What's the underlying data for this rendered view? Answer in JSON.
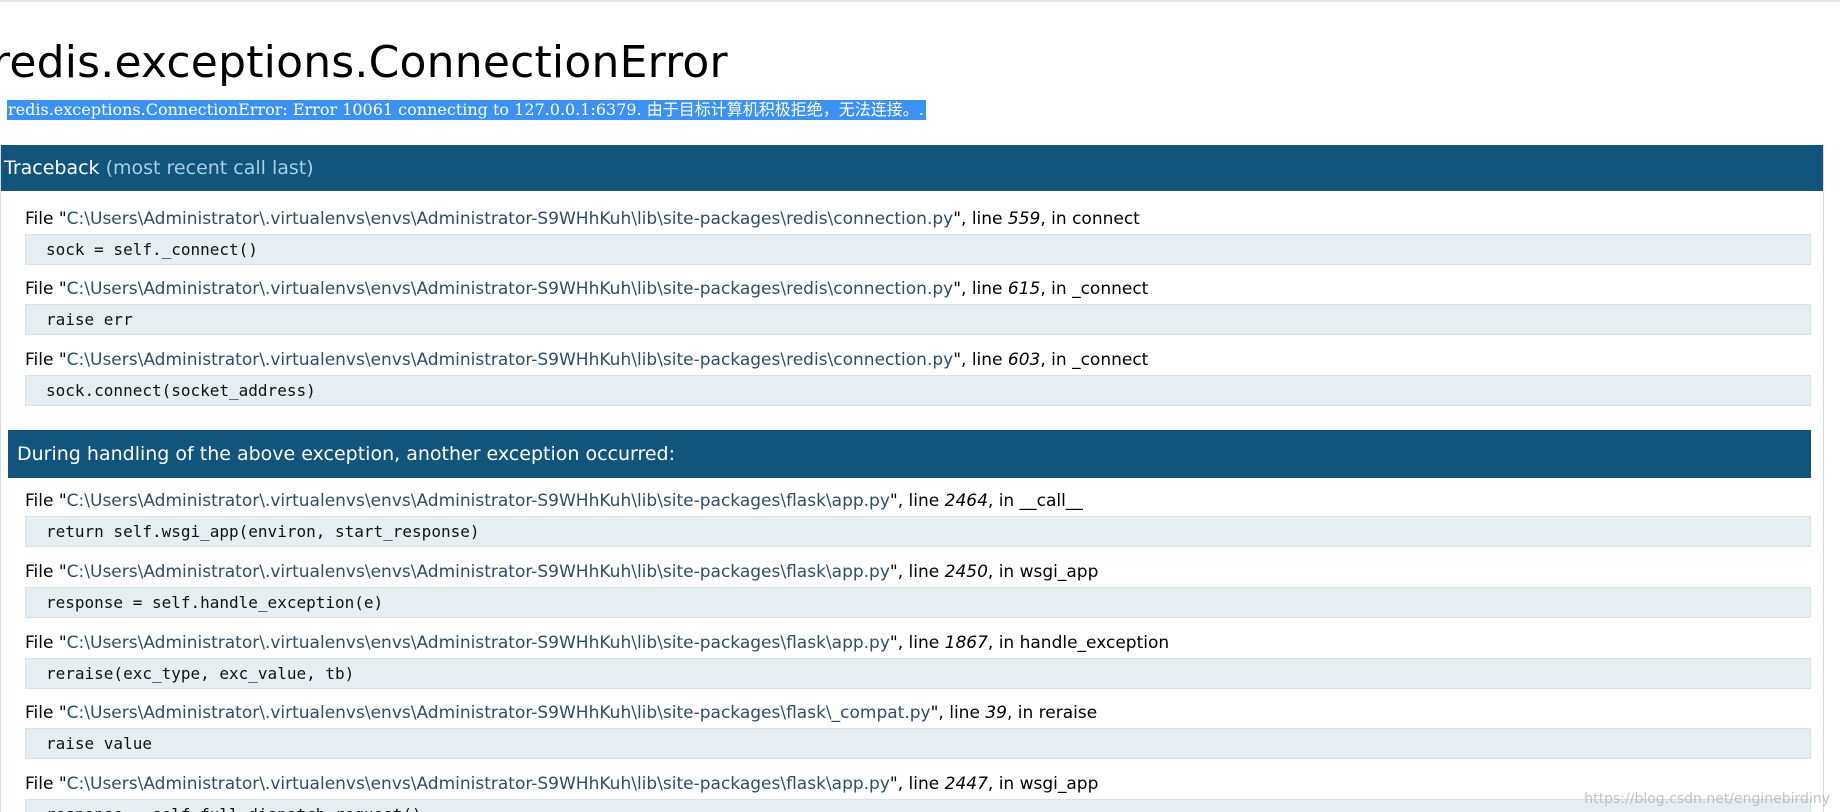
{
  "page": {
    "title": "redis.exceptions.ConnectionError",
    "error_message": "redis.exceptions.ConnectionError: Error 10061 connecting to 127.0.0.1:6379. 由于目标计算机积极拒绝，无法连接。."
  },
  "traceback": {
    "header_label": "Traceback",
    "header_hint": "(most recent call last)",
    "frames_before": [
      {
        "prefix": "File \"",
        "path": "C:\\Users\\Administrator\\.virtualenvs\\envs\\Administrator-S9WHhKuh\\lib\\site-packages\\redis\\connection.py",
        "mid": "\", line ",
        "lineno": "559",
        "in_text": ", in connect",
        "code": "sock = self._connect()"
      },
      {
        "prefix": "File \"",
        "path": "C:\\Users\\Administrator\\.virtualenvs\\envs\\Administrator-S9WHhKuh\\lib\\site-packages\\redis\\connection.py",
        "mid": "\", line ",
        "lineno": "615",
        "in_text": ", in _connect",
        "code": "raise err"
      },
      {
        "prefix": "File \"",
        "path": "C:\\Users\\Administrator\\.virtualenvs\\envs\\Administrator-S9WHhKuh\\lib\\site-packages\\redis\\connection.py",
        "mid": "\", line ",
        "lineno": "603",
        "in_text": ", in _connect",
        "code": "sock.connect(socket_address)"
      }
    ],
    "divider_text": "During handling of the above exception, another exception occurred:",
    "frames_after": [
      {
        "prefix": "File \"",
        "path": "C:\\Users\\Administrator\\.virtualenvs\\envs\\Administrator-S9WHhKuh\\lib\\site-packages\\flask\\app.py",
        "mid": "\", line ",
        "lineno": "2464",
        "in_text": ", in __call__",
        "code": "return self.wsgi_app(environ, start_response)"
      },
      {
        "prefix": "File \"",
        "path": "C:\\Users\\Administrator\\.virtualenvs\\envs\\Administrator-S9WHhKuh\\lib\\site-packages\\flask\\app.py",
        "mid": "\", line ",
        "lineno": "2450",
        "in_text": ", in wsgi_app",
        "code": "response = self.handle_exception(e)"
      },
      {
        "prefix": "File \"",
        "path": "C:\\Users\\Administrator\\.virtualenvs\\envs\\Administrator-S9WHhKuh\\lib\\site-packages\\flask\\app.py",
        "mid": "\", line ",
        "lineno": "1867",
        "in_text": ", in handle_exception",
        "code": "reraise(exc_type, exc_value, tb)"
      },
      {
        "prefix": "File \"",
        "path": "C:\\Users\\Administrator\\.virtualenvs\\envs\\Administrator-S9WHhKuh\\lib\\site-packages\\flask\\_compat.py",
        "mid": "\", line ",
        "lineno": "39",
        "in_text": ", in reraise",
        "code": "raise value"
      },
      {
        "prefix": "File \"",
        "path": "C:\\Users\\Administrator\\.virtualenvs\\envs\\Administrator-S9WHhKuh\\lib\\site-packages\\flask\\app.py",
        "mid": "\", line ",
        "lineno": "2447",
        "in_text": ", in wsgi_app",
        "code": "response = self.full_dispatch_request()"
      }
    ]
  },
  "watermark": "https://blog.csdn.net/enginebirdiny",
  "colors": {
    "header_bg": "#11557c",
    "code_bg": "#e6eef1",
    "selection_bg": "#3b92f3",
    "path_text": "#2c4e68"
  }
}
